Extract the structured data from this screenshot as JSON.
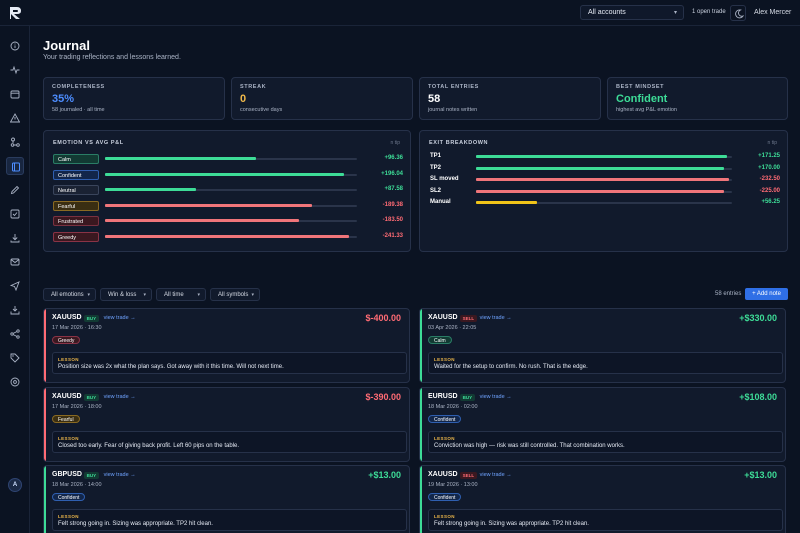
{
  "topbar": {
    "account": "All accounts",
    "open_trade": "1 open trade",
    "user": "Alex Mercer"
  },
  "page": {
    "title": "Journal",
    "subtitle": "Your trading reflections and lessons learned."
  },
  "stats": [
    {
      "label": "COMPLETENESS",
      "value": "35%",
      "sub": "58 journaled · all time",
      "color": "#4d8dff"
    },
    {
      "label": "STREAK",
      "value": "0",
      "sub": "consecutive days",
      "color": "#f0b94a"
    },
    {
      "label": "TOTAL ENTRIES",
      "value": "58",
      "sub": "journal notes written",
      "color": "#ffffff"
    },
    {
      "label": "BEST MINDSET",
      "value": "Confident",
      "sub": "highest avg P&L emotion",
      "color": "#3ddc97"
    }
  ],
  "emotion_panel": {
    "title": "EMOTION VS AVG P&L",
    "note": "n tip",
    "rows": [
      {
        "label": "Calm",
        "value": "+96.36",
        "fill": 0.6,
        "tag_bg": "#123a33",
        "tag_border": "#2a7d66",
        "bar": "#3ddc97",
        "val_color": "#3ddc97"
      },
      {
        "label": "Confident",
        "value": "+196.04",
        "fill": 0.95,
        "tag_bg": "#12264a",
        "tag_border": "#2f5fb0",
        "bar": "#3ddc97",
        "val_color": "#3ddc97"
      },
      {
        "label": "Neutral",
        "value": "+87.58",
        "fill": 0.36,
        "tag_bg": "#1a2233",
        "tag_border": "#3a455c",
        "bar": "#3ddc97",
        "val_color": "#3ddc97"
      },
      {
        "label": "Fearful",
        "value": "-189.38",
        "fill": 0.82,
        "tag_bg": "#3a2e12",
        "tag_border": "#8a6a22",
        "bar": "#f0757a",
        "val_color": "#ff6b74"
      },
      {
        "label": "Frustrated",
        "value": "-183.50",
        "fill": 0.77,
        "tag_bg": "#3a1820",
        "tag_border": "#7a3040",
        "bar": "#f0757a",
        "val_color": "#ff6b74"
      },
      {
        "label": "Greedy",
        "value": "-241.33",
        "fill": 0.97,
        "tag_bg": "#3a1820",
        "tag_border": "#8a3346",
        "bar": "#f0757a",
        "val_color": "#ff6b74"
      }
    ]
  },
  "exit_panel": {
    "title": "EXIT BREAKDOWN",
    "note": "n tip",
    "rows": [
      {
        "label": "TP1",
        "value": "+171.25",
        "fill": 0.98,
        "bar": "#3ddc97",
        "val_color": "#3ddc97"
      },
      {
        "label": "TP2",
        "value": "+170.00",
        "fill": 0.97,
        "bar": "#3ddc97",
        "val_color": "#3ddc97"
      },
      {
        "label": "SL moved",
        "value": "-232.50",
        "fill": 0.99,
        "bar": "#f0757a",
        "val_color": "#ff6b74"
      },
      {
        "label": "SL2",
        "value": "-225.00",
        "fill": 0.97,
        "bar": "#f0757a",
        "val_color": "#ff6b74"
      },
      {
        "label": "Manual",
        "value": "+56.25",
        "fill": 0.24,
        "bar": "#f0c419",
        "val_color": "#3ddc97"
      }
    ]
  },
  "filters": {
    "emotions": "All emotions",
    "winloss": "Win & loss",
    "time": "All time",
    "symbols": "All symbols",
    "entries": "58 entries",
    "add_note": "+ Add note"
  },
  "cards": [
    {
      "symbol": "XAUUSD",
      "side": "BUY",
      "view": "view trade →",
      "date": "17 Mar 2026 · 16:30",
      "pnl": "$-400.00",
      "emotion": "Greedy",
      "lesson_label": "LESSON",
      "lesson": "Position size was 2x what the plan says. Got away with it this time. Will not next time."
    },
    {
      "symbol": "XAUUSD",
      "side": "SELL",
      "view": "view trade →",
      "date": "03 Apr 2026 · 22:05",
      "pnl": "+$330.00",
      "emotion": "Calm",
      "lesson_label": "LESSON",
      "lesson": "Waited for the setup to confirm. No rush. That is the edge."
    },
    {
      "symbol": "XAUUSD",
      "side": "BUY",
      "view": "view trade →",
      "date": "17 Mar 2026 · 18:00",
      "pnl": "$-390.00",
      "emotion": "Fearful",
      "lesson_label": "LESSON",
      "lesson": "Closed too early. Fear of giving back profit. Left 60 pips on the table."
    },
    {
      "symbol": "EURUSD",
      "side": "BUY",
      "view": "view trade →",
      "date": "18 Mar 2026 · 02:00",
      "pnl": "+$108.00",
      "emotion": "Confident",
      "lesson_label": "LESSON",
      "lesson": "Conviction was high — risk was still controlled. That combination works."
    },
    {
      "symbol": "GBPUSD",
      "side": "BUY",
      "view": "view trade →",
      "date": "18 Mar 2026 · 14:00",
      "pnl": "+$13.00",
      "emotion": "Confident",
      "lesson_label": "LESSON",
      "lesson": "Felt strong going in. Sizing was appropriate. TP2 hit clean."
    },
    {
      "symbol": "XAUUSD",
      "side": "SELL",
      "view": "view trade →",
      "date": "19 Mar 2026 · 13:00",
      "pnl": "+$13.00",
      "emotion": "Confident",
      "lesson_label": "LESSON",
      "lesson": "Felt strong going in. Sizing was appropriate. TP2 hit clean."
    }
  ],
  "colors": {
    "win": "#3ddc97",
    "loss": "#ff6b74",
    "accent": "#2f6fe6",
    "buy_bg": "#123a33",
    "buy_text": "#3ddc97",
    "sell_bg": "#3a1820",
    "sell_text": "#ff6b74"
  }
}
